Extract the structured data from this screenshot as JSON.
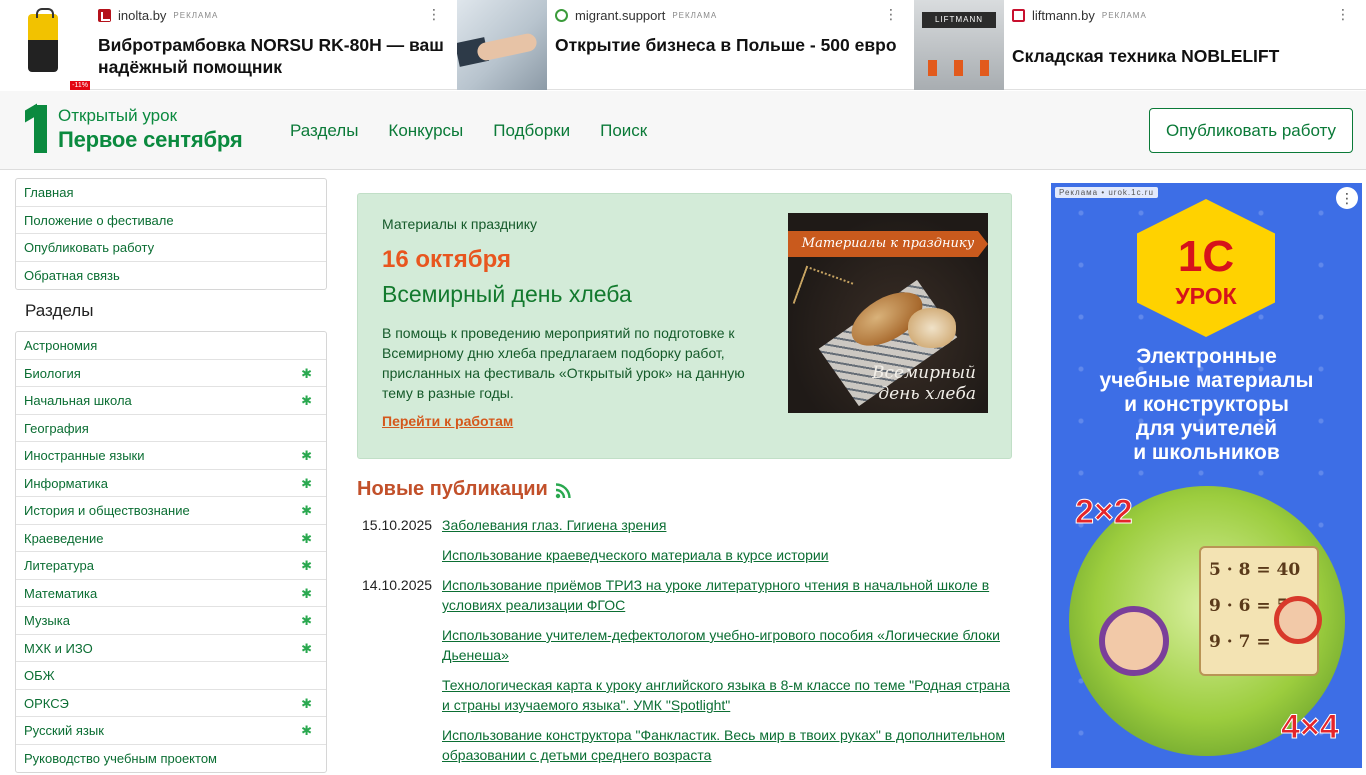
{
  "ads": [
    {
      "domain": "inolta.by",
      "tag": "Реклама",
      "title": "Вибротрамбовка NORSU RK-80H — ваш надёжный помощник",
      "thumb_badge": "-11%",
      "favicon": "red-brand-icon"
    },
    {
      "domain": "migrant.support",
      "tag": "Реклама",
      "title": "Открытие бизнеса в Польше - 500 евро",
      "favicon": "globe-icon"
    },
    {
      "domain": "liftmann.by",
      "tag": "Реклама",
      "title": "Складская техника NOBLELIFT",
      "thumb_logo": "LIFTMANN",
      "favicon": "liftmann-icon"
    }
  ],
  "header": {
    "logo_top": "Открытый урок",
    "logo_main": "Первое сентября",
    "nav": [
      "Разделы",
      "Конкурсы",
      "Подборки",
      "Поиск"
    ],
    "publish_label": "Опубликовать работу"
  },
  "sidebar": {
    "top_links": [
      "Главная",
      "Положение о фестивале",
      "Опубликовать работу",
      "Обратная связь"
    ],
    "sections_heading": "Разделы",
    "sections": [
      {
        "label": "Астрономия",
        "marked": false
      },
      {
        "label": "Биология",
        "marked": true
      },
      {
        "label": "Начальная школа",
        "marked": true
      },
      {
        "label": "География",
        "marked": false
      },
      {
        "label": "Иностранные языки",
        "marked": true
      },
      {
        "label": "Информатика",
        "marked": true
      },
      {
        "label": "История и обществознание",
        "marked": true
      },
      {
        "label": "Краеведение",
        "marked": true
      },
      {
        "label": "Литература",
        "marked": true
      },
      {
        "label": "Математика",
        "marked": true
      },
      {
        "label": "Музыка",
        "marked": true
      },
      {
        "label": "МХК и ИЗО",
        "marked": true
      },
      {
        "label": "ОБЖ",
        "marked": false
      },
      {
        "label": "ОРКСЭ",
        "marked": true
      },
      {
        "label": "Русский язык",
        "marked": true
      },
      {
        "label": "Руководство учебным проектом",
        "marked": false
      }
    ],
    "mark_glyph": "✱"
  },
  "promo": {
    "kicker": "Материалы к празднику",
    "date": "16 октября",
    "title": "Всемирный день хлеба",
    "text": "В помощь к проведению мероприятий по подготовке к Всемирному дню хлеба предлагаем подборку работ, присланных на фестиваль «Открытый урок» на данную тему в разные годы.",
    "link": "Перейти к работам",
    "image_banner": "Материалы к празднику",
    "image_caption_1": "Всемирный",
    "image_caption_2": "день хлеба"
  },
  "news": {
    "heading": "Новые публикации",
    "items": [
      {
        "date": "15.10.2025",
        "title": "Заболевания глаз. Гигиена зрения"
      },
      {
        "date": "",
        "title": "Использование краеведческого материала в курсе истории"
      },
      {
        "date": "14.10.2025",
        "title": "Использование приёмов ТРИЗ на уроке литературного чтения в начальной школе в условиях реализации ФГОС"
      },
      {
        "date": "",
        "title": "Использование учителем-дефектологом учебно-игрового пособия «Логические блоки Дьенеша»"
      },
      {
        "date": "",
        "title": "Технологическая карта к уроку английского языка в 8-м классе по теме \"Родная страна и страны изучаемого языка\". УМК \"Spotlight\""
      },
      {
        "date": "",
        "title": "Использование конструктора \"Фанкластик. Весь мир в твоих руках\" в дополнительном образовании с детьми среднего возраста"
      }
    ]
  },
  "right_ad": {
    "tag": "Реклама • urok.1c.ru",
    "logo_line1": "1С",
    "logo_line2": "УРОК",
    "headline": [
      "Электронные",
      "учебные материалы",
      "и конструкторы",
      "для учителей",
      "и школьников"
    ],
    "math": [
      "5 · 8 = 40",
      "9 · 6 = 54",
      "9 · 7 ="
    ],
    "badge_left": "2×2",
    "badge_right": "4×4"
  },
  "colors": {
    "brand_green": "#0b8a3f",
    "accent_orange": "#e8561f",
    "promo_bg": "#d3ebd8",
    "right_ad_bg": "#3d6ee6"
  }
}
